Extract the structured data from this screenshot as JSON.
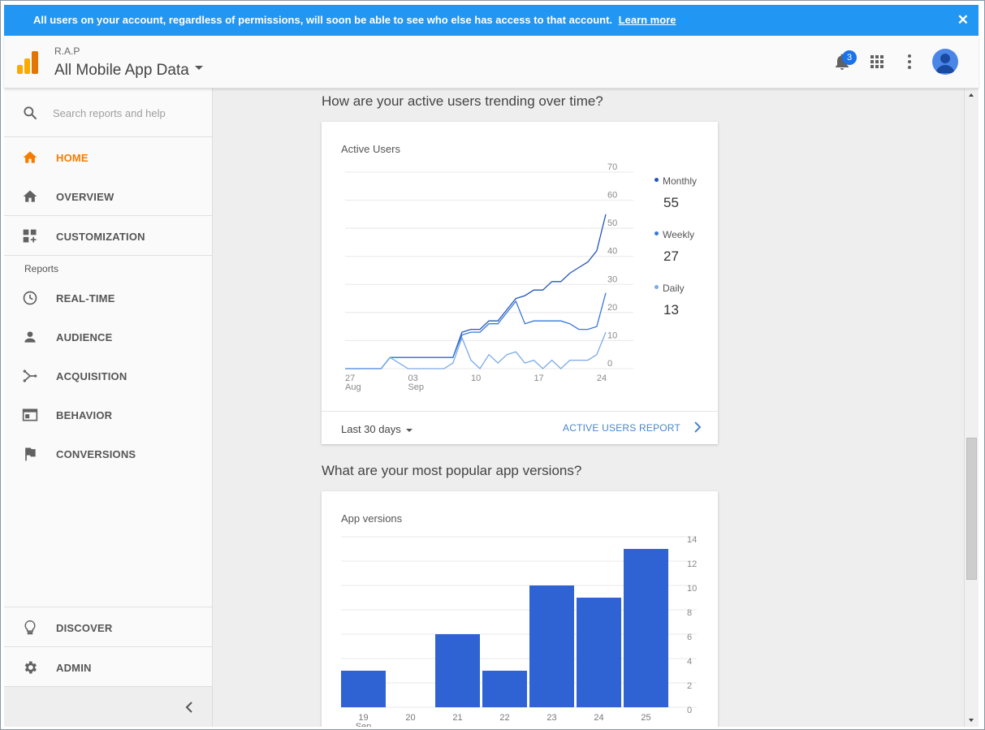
{
  "banner": {
    "message": "All users on your account, regardless of permissions, will soon be able to see who else has access to that account.",
    "link": "Learn more",
    "close": "✕"
  },
  "header": {
    "account": "R.A.P",
    "view": "All Mobile App Data",
    "notification_count": "3"
  },
  "sidebar": {
    "search_placeholder": "Search reports and help",
    "items": [
      {
        "label": "HOME",
        "icon": "home-icon",
        "active": true
      },
      {
        "label": "OVERVIEW",
        "icon": "home-icon"
      },
      {
        "label": "CUSTOMIZATION",
        "icon": "dashboard-add-icon"
      }
    ],
    "reports_heading": "Reports",
    "reports": [
      {
        "label": "REAL-TIME",
        "icon": "clock-icon"
      },
      {
        "label": "AUDIENCE",
        "icon": "person-icon"
      },
      {
        "label": "ACQUISITION",
        "icon": "acquisition-icon"
      },
      {
        "label": "BEHAVIOR",
        "icon": "behavior-icon"
      },
      {
        "label": "CONVERSIONS",
        "icon": "flag-icon"
      }
    ],
    "bottom": [
      {
        "label": "DISCOVER",
        "icon": "lightbulb-icon"
      },
      {
        "label": "ADMIN",
        "icon": "gear-icon"
      }
    ]
  },
  "main": {
    "q1": "How are your active users trending over time?",
    "q2": "What are your most popular app versions?",
    "active_users_card": {
      "title": "Active Users",
      "legend": [
        {
          "name": "Monthly",
          "value": "55",
          "color": "#2456b8"
        },
        {
          "name": "Weekly",
          "value": "27",
          "color": "#3a78d8"
        },
        {
          "name": "Daily",
          "value": "13",
          "color": "#7aaae8"
        }
      ],
      "range": "Last 30 days",
      "report_link": "ACTIVE USERS REPORT"
    },
    "app_versions_card": {
      "title": "App versions"
    }
  },
  "chart_data": [
    {
      "type": "line",
      "title": "Active Users",
      "x_ticks": [
        "27\nAug",
        "03\nSep",
        "10",
        "17",
        "24"
      ],
      "y_ticks": [
        0,
        10,
        20,
        30,
        40,
        50,
        60,
        70
      ],
      "ylim": [
        0,
        70
      ],
      "x": [
        27,
        28,
        29,
        30,
        31,
        1,
        2,
        3,
        4,
        5,
        6,
        7,
        8,
        9,
        10,
        11,
        12,
        13,
        14,
        15,
        16,
        17,
        18,
        19,
        20,
        21,
        22,
        23,
        24,
        25
      ],
      "series": [
        {
          "name": "Monthly",
          "color": "#2456b8",
          "values": [
            0,
            0,
            0,
            0,
            0,
            4,
            4,
            4,
            4,
            4,
            4,
            4,
            4,
            13,
            14,
            14,
            17,
            17,
            21,
            25,
            26,
            28,
            28,
            31,
            31,
            34,
            36,
            38,
            42,
            55
          ]
        },
        {
          "name": "Weekly",
          "color": "#3a78d8",
          "values": [
            0,
            0,
            0,
            0,
            0,
            4,
            4,
            4,
            4,
            4,
            4,
            4,
            4,
            12,
            13,
            13,
            16,
            16,
            20,
            24,
            16,
            17,
            17,
            17,
            17,
            16,
            14,
            14,
            15,
            27
          ]
        },
        {
          "name": "Daily",
          "color": "#7aaae8",
          "values": [
            0,
            0,
            0,
            0,
            0,
            4,
            2,
            0,
            0,
            0,
            0,
            0,
            2,
            11,
            3,
            0,
            5,
            2,
            5,
            6,
            2,
            3,
            0,
            3,
            0,
            3,
            3,
            3,
            5,
            13
          ]
        }
      ],
      "grid": true,
      "legend": "right"
    },
    {
      "type": "bar",
      "title": "App versions",
      "categories": [
        "19\nSep",
        "20",
        "21",
        "22",
        "23",
        "24",
        "25"
      ],
      "values": [
        3,
        0,
        6,
        3,
        10,
        9,
        13
      ],
      "y_ticks": [
        0,
        2,
        4,
        6,
        8,
        10,
        12,
        14
      ],
      "ylim": [
        0,
        14
      ],
      "color": "#2f63d4",
      "grid": true
    }
  ]
}
